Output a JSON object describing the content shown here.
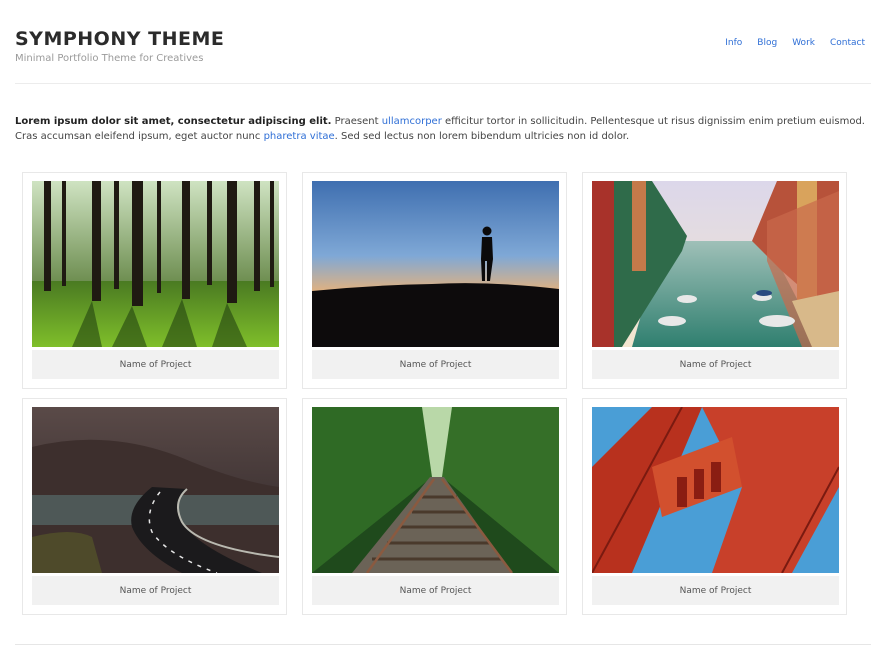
{
  "header": {
    "title": "SYMPHONY THEME",
    "tagline": "Minimal Portfolio Theme for Creatives"
  },
  "nav": {
    "items": [
      {
        "label": "Info"
      },
      {
        "label": "Blog"
      },
      {
        "label": "Work"
      },
      {
        "label": "Contact"
      }
    ]
  },
  "intro": {
    "lead": "Lorem ipsum dolor sit amet, consectetur adipiscing elit.",
    "text1": " Praesent ",
    "link1": "ullamcorper",
    "text2": " efficitur tortor in sollicitudin. Pellentesque ut risus dignissim enim pretium euismod. Cras accumsan eleifend ipsum, eget auctor nunc ",
    "link2": "pharetra vitae",
    "text3": ". Sed sed lectus non lorem bibendum ultricies non id dolor."
  },
  "projects": [
    {
      "caption": "Name of Project",
      "image": "forest-photo"
    },
    {
      "caption": "Name of Project",
      "image": "sunset-silhouette-photo"
    },
    {
      "caption": "Name of Project",
      "image": "canal-boats-photo"
    },
    {
      "caption": "Name of Project",
      "image": "winding-road-photo"
    },
    {
      "caption": "Name of Project",
      "image": "railway-tracks-photo"
    },
    {
      "caption": "Name of Project",
      "image": "red-bridge-tower-photo"
    }
  ],
  "colors": {
    "link": "#2f6fd6",
    "caption_bg": "#f1f1f1"
  }
}
